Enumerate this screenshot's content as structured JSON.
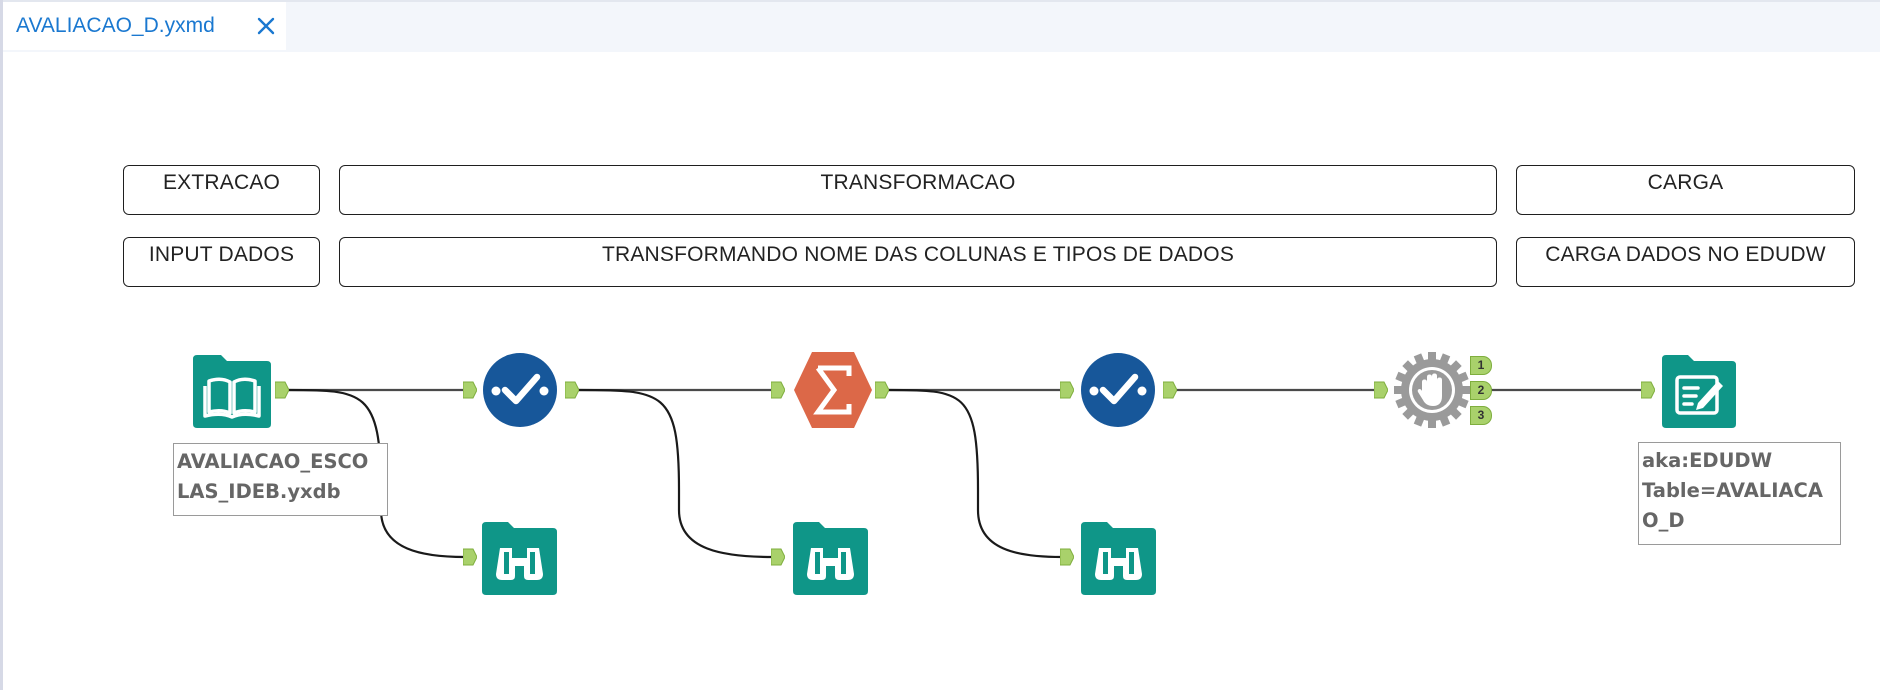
{
  "tab": {
    "title": "AVALIACAO_D.yxmd"
  },
  "comments": {
    "extracao": "EXTRACAO",
    "transformacao": "TRANSFORMACAO",
    "carga": "CARGA",
    "input_dados": "INPUT DADOS",
    "transformando": "TRANSFORMANDO NOME DAS COLUNAS E TIPOS DE DADOS",
    "carga_dados": "CARGA DADOS NO EDUDW"
  },
  "tools": {
    "input": {
      "icon": "book-icon",
      "label_line1": "AVALIACAO_ESCO",
      "label_line2": "LAS_IDEB.yxdb"
    },
    "select1": {
      "icon": "select-checkmark-icon"
    },
    "summarize": {
      "icon": "sigma-icon"
    },
    "select2": {
      "icon": "select-checkmark-icon"
    },
    "block_until_done": {
      "icon": "hand-stop-icon",
      "outputs": [
        "1",
        "2",
        "3"
      ]
    },
    "output": {
      "icon": "output-edit-icon",
      "label_line1": "aka:EDUDW",
      "label_line2": "Table=AVALIACA",
      "label_line3": "O_D"
    },
    "browse": {
      "icon": "binoculars-icon"
    }
  },
  "colors": {
    "teal": "#0f9688",
    "navy": "#17579a",
    "orange": "#dc6848",
    "gray": "#9a9a9a",
    "anchor": "#a9d16b"
  }
}
